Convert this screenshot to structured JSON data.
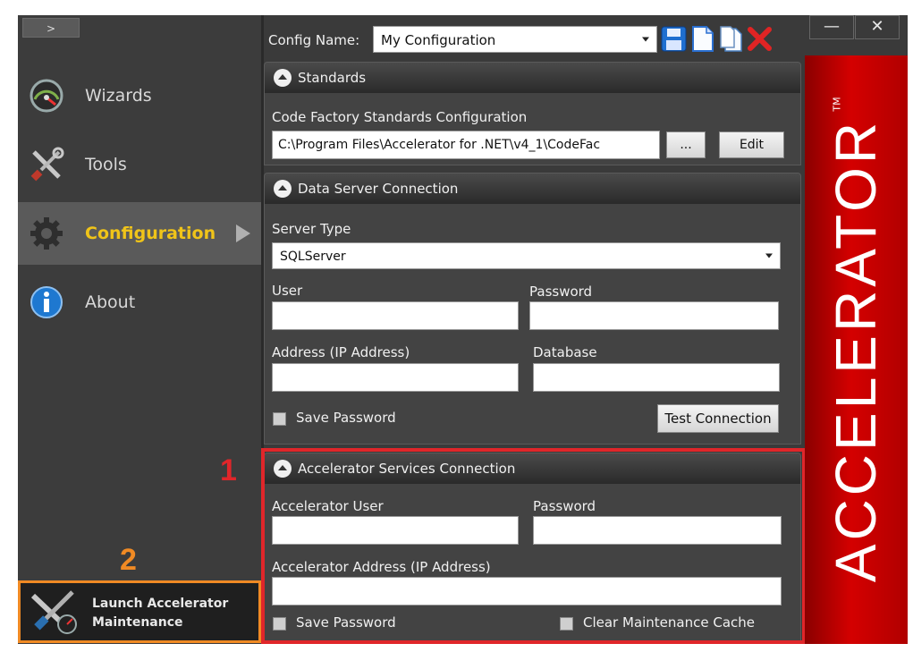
{
  "sidebar": {
    "expand_label": ">",
    "items": [
      {
        "label": "Wizards",
        "icon": "speedometer-icon"
      },
      {
        "label": "Tools",
        "icon": "tools-icon"
      },
      {
        "label": "Configuration",
        "icon": "gear-icon",
        "active": true
      },
      {
        "label": "About",
        "icon": "info-icon"
      }
    ],
    "launch_line1": "Launch Accelerator",
    "launch_line2": "Maintenance"
  },
  "annotations": {
    "one": "1",
    "two": "2",
    "red": "#e0262a",
    "orange": "#f08a24"
  },
  "window": {
    "minimize": "—",
    "close": "✕"
  },
  "config": {
    "label": "Config Name:",
    "value": "My Configuration",
    "icons": [
      "save-icon",
      "new-document-icon",
      "copy-document-icon",
      "delete-icon"
    ]
  },
  "standards": {
    "title": "Standards",
    "label": "Code Factory Standards Configuration",
    "path": "C:\\Program Files\\Accelerator for .NET\\v4_1\\CodeFac",
    "browse": "...",
    "edit": "Edit"
  },
  "data_server": {
    "title": "Data Server Connection",
    "server_type_label": "Server Type",
    "server_type": "SQLServer",
    "user_label": "User",
    "password_label": "Password",
    "address_label": "Address (IP Address)",
    "database_label": "Database",
    "save_password": "Save Password",
    "test_connection": "Test Connection"
  },
  "services": {
    "title": "Accelerator Services Connection",
    "user_label": "Accelerator User",
    "password_label": "Password",
    "address_label": "Accelerator Address (IP Address)",
    "save_password": "Save Password",
    "clear_cache": "Clear Maintenance Cache"
  },
  "brand": {
    "name": "ACCELERATOR",
    "tm": "TM",
    "color": "#c00000"
  }
}
